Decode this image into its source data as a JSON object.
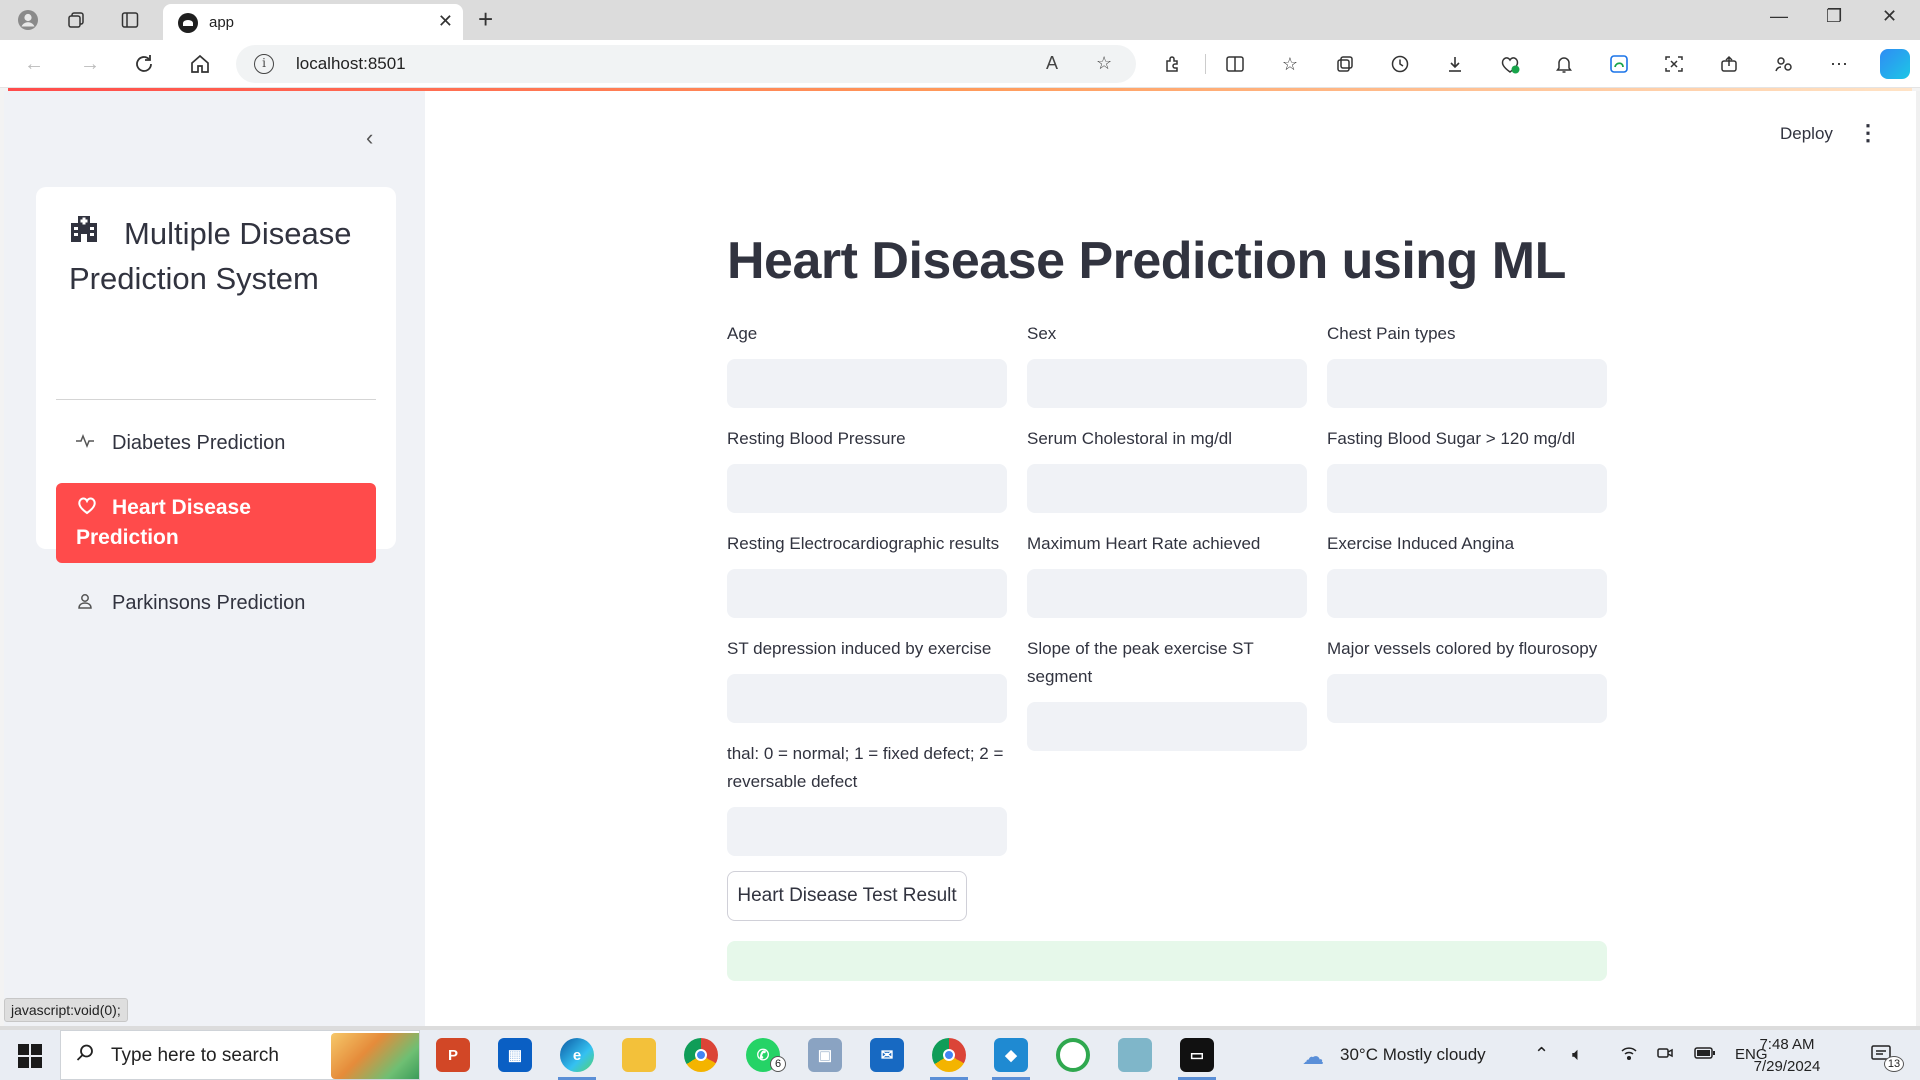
{
  "browser": {
    "tab_title": "app",
    "tab_close": "✕",
    "new_tab": "+",
    "url": "localhost:8501",
    "read_aloud": "A",
    "window_controls": {
      "minimize": "—",
      "restore": "❐",
      "close": "✕"
    }
  },
  "app": {
    "sidebar": {
      "collapse_glyph": "‹",
      "menu_title": "Multiple Disease Prediction System",
      "items": [
        {
          "label": "Diabetes Prediction",
          "icon": "activity-icon",
          "active": false
        },
        {
          "label": "Heart Disease Prediction",
          "icon": "heart-icon",
          "active": true
        },
        {
          "label": "Parkinsons Prediction",
          "icon": "person-icon",
          "active": false
        }
      ]
    },
    "header": {
      "deploy_label": "Deploy",
      "menu_glyph": "⋮"
    },
    "title": "Heart Disease Prediction using ML",
    "fields": [
      {
        "label": "Age",
        "value": ""
      },
      {
        "label": "Sex",
        "value": ""
      },
      {
        "label": "Chest Pain types",
        "value": ""
      },
      {
        "label": "Resting Blood Pressure",
        "value": ""
      },
      {
        "label": "Serum Cholestoral in mg/dl",
        "value": ""
      },
      {
        "label": "Fasting Blood Sugar > 120 mg/dl",
        "value": ""
      },
      {
        "label": "Resting Electrocardiographic results",
        "value": ""
      },
      {
        "label": "Maximum Heart Rate achieved",
        "value": ""
      },
      {
        "label": "Exercise Induced Angina",
        "value": ""
      },
      {
        "label": "ST depression induced by exercise",
        "value": ""
      },
      {
        "label": "Slope of the peak exercise ST segment",
        "value": ""
      },
      {
        "label": "Major vessels colored by flourosopy",
        "value": ""
      },
      {
        "label": "thal: 0 = normal; 1 = fixed defect; 2 = reversable defect",
        "value": ""
      }
    ],
    "button_label": "Heart Disease Test Result",
    "status_link": "javascript:void(0);",
    "accent": "#ff4b4b",
    "success_bg": "#e6f8ea"
  },
  "taskbar": {
    "search_placeholder": "Type here to search",
    "whatsapp_badge": "6",
    "weather": "30°C  Mostly cloudy",
    "language": "ENG",
    "time": "7:48 AM",
    "date": "7/29/2024",
    "notifications": "13"
  }
}
